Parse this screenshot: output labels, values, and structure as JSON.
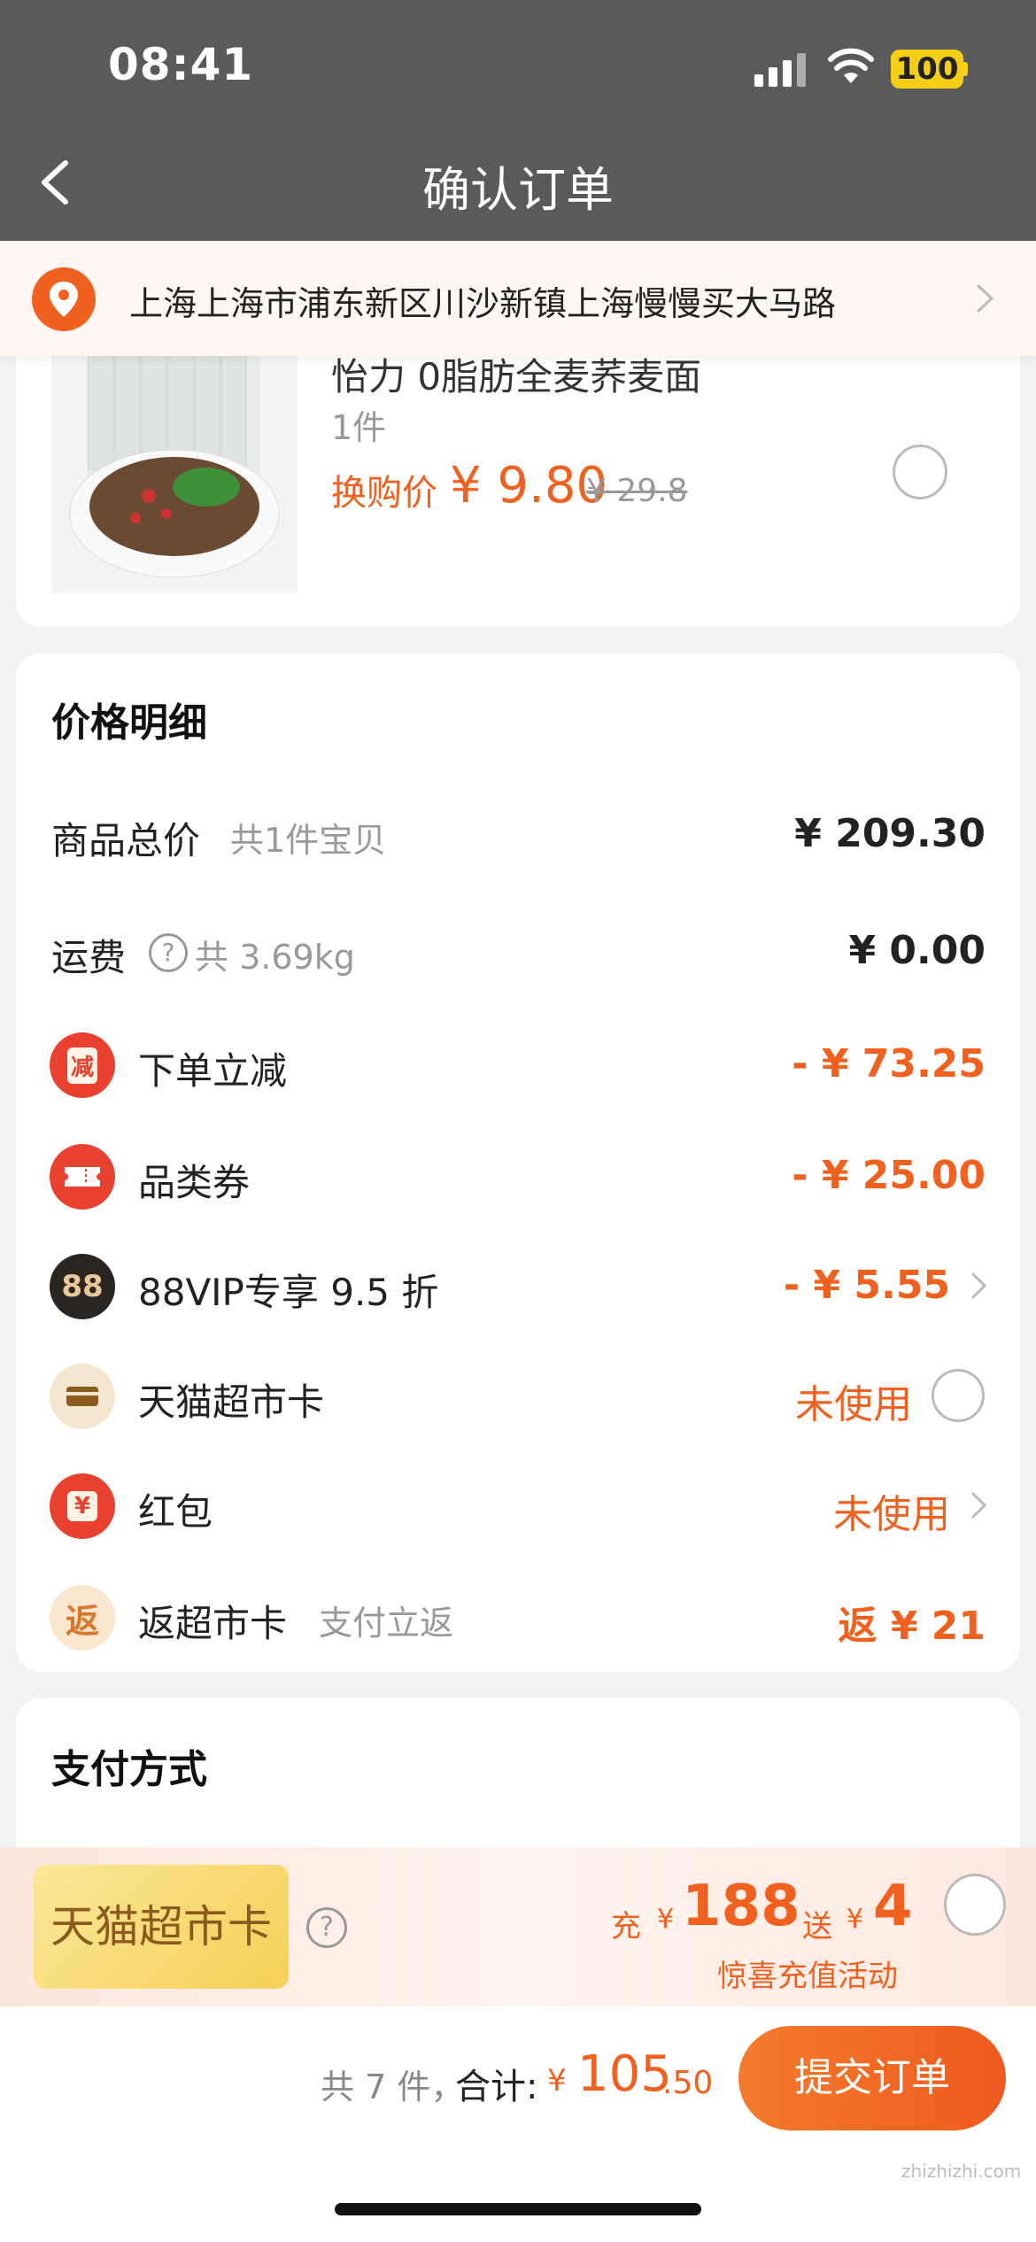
{
  "status_bar": {
    "time": "08:41",
    "battery": "100"
  },
  "header": {
    "title": "确认订单"
  },
  "address": {
    "text": "上海上海市浦东新区川沙新镇上海慢慢买大马路"
  },
  "product": {
    "name": "怡力 0脂肪全麦荞麦面",
    "qty": "1件",
    "swap_label": "换购价",
    "price": "¥ 9.80",
    "original_price": "¥ 29.8"
  },
  "price_detail": {
    "title": "价格明细",
    "rows": [
      {
        "label": "商品总价",
        "sub": "共1件宝贝",
        "value": "¥ 209.30"
      },
      {
        "label": "运费",
        "sub": "共 3.69kg",
        "value": "¥ 0.00"
      },
      {
        "icon": "减",
        "label": "下单立减",
        "value": "- ¥ 73.25"
      },
      {
        "label": "品类券",
        "value": "- ¥ 25.00"
      },
      {
        "icon": "88",
        "label": "88VIP专享 9.5 折",
        "value": "- ¥ 5.55"
      },
      {
        "label": "天猫超市卡",
        "value": "未使用"
      },
      {
        "icon": "¥",
        "label": "红包",
        "value": "未使用"
      },
      {
        "icon": "返",
        "label": "返超市卡",
        "sub": "支付立返",
        "value": "返 ¥ 21"
      }
    ]
  },
  "payment": {
    "title": "支付方式",
    "card_name": "天猫超市卡",
    "recharge_prefix": "充",
    "recharge_amount": "188",
    "gift_prefix": "送",
    "gift_amount": "4",
    "currency": "¥",
    "promo_sub": "惊喜充值活动"
  },
  "footer": {
    "count_text": "共 7 件，",
    "total_label": "合计:",
    "currency": "¥",
    "total": "105",
    "total_decimal": ".50",
    "submit_label": "提交订单"
  },
  "watermark": "zhizhizhi.com",
  "colors": {
    "accent": "#f0601f",
    "header_bg": "#5a5a5a"
  }
}
